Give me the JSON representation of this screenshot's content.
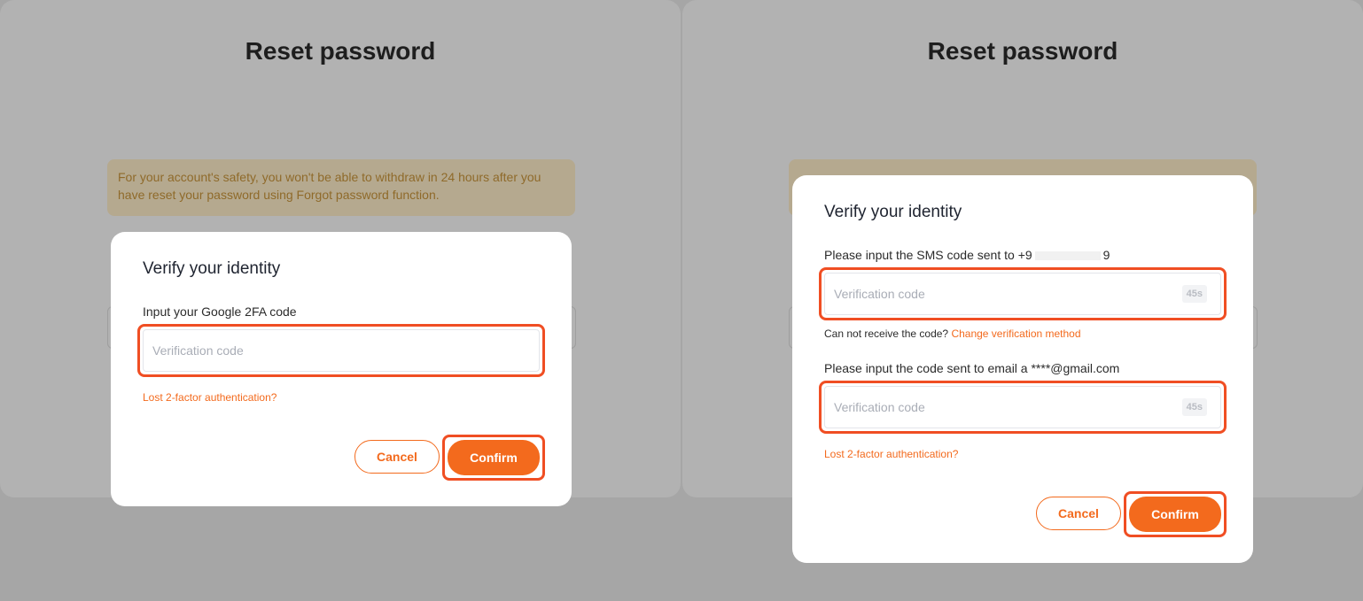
{
  "left": {
    "title": "Reset password",
    "notice": "For your account's safety, you won't be able to withdraw in 24 hours after you have reset your password using Forgot password function.",
    "modal": {
      "title": "Verify your identity",
      "label": "Input your Google 2FA code",
      "placeholder": "Verification code",
      "lost_link": "Lost 2-factor authentication?",
      "cancel": "Cancel",
      "confirm": "Confirm"
    }
  },
  "right": {
    "title": "Reset password",
    "modal": {
      "title": "Verify your identity",
      "sms_label_prefix": "Please input the SMS code sent to +9",
      "sms_label_suffix": "9",
      "sms_placeholder": "Verification code",
      "sms_timer": "45s",
      "hint_text": "Can not receive the code?",
      "change_method_link": "Change verification method",
      "email_label": "Please input the code sent to email a  ****@gmail.com",
      "email_placeholder": "Verification code",
      "email_timer": "45s",
      "lost_link": "Lost 2-factor authentication?",
      "cancel": "Cancel",
      "confirm": "Confirm"
    }
  },
  "colors": {
    "accent": "#f36a1d",
    "highlight": "#f04e23",
    "overlay": "#a6a6a6"
  }
}
